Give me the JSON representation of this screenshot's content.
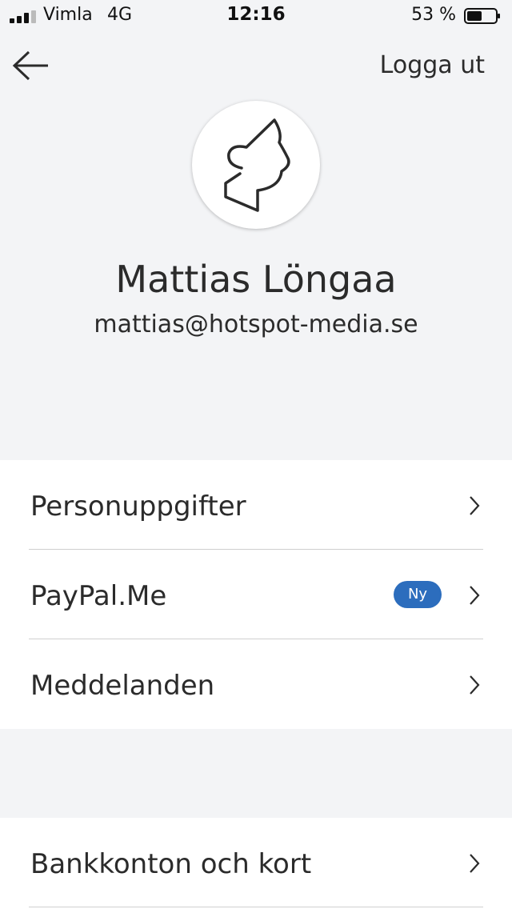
{
  "status_bar": {
    "carrier": "Vimla",
    "network": "4G",
    "time": "12:16",
    "battery": "53 %",
    "battery_level": 0.53
  },
  "header": {
    "back_icon": "arrow-left-icon",
    "logout_label": "Logga ut"
  },
  "profile": {
    "avatar_icon": "profile-silhouette-icon",
    "name": "Mattias Löngaa",
    "email": "mattias@hotspot-media.se"
  },
  "menu": {
    "items": [
      {
        "label": "Personuppgifter"
      },
      {
        "label": "PayPal.Me",
        "badge": "Ny"
      },
      {
        "label": "Meddelanden"
      }
    ]
  },
  "menu2": {
    "items": [
      {
        "label": "Bankkonton och kort"
      }
    ]
  },
  "colors": {
    "background": "#f3f4f6",
    "badge": "#2c6dbd",
    "text": "#2b2b2b"
  }
}
